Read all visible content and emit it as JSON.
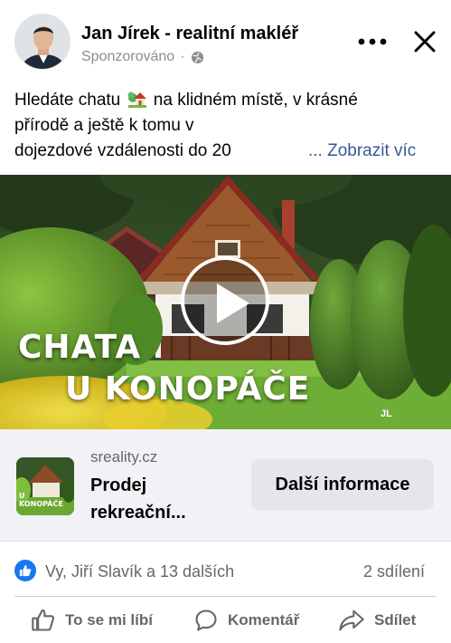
{
  "post": {
    "author": "Jan Jírek - realitní makléř",
    "sponsored": "Sponzorováno",
    "separator": "·",
    "icons": {
      "audience": "globe-icon",
      "more": "more-options-icon",
      "close": "close-icon"
    },
    "text_lines": [
      {
        "before": "Hledáte chatu",
        "emoji": "house-with-garden-emoji",
        "after": " na klidném místě, v krásné"
      },
      {
        "text": "přírodě a ještě k tomu v"
      },
      {
        "text": "dojezdové vzdálenosti do 20"
      }
    ],
    "see_more": "... Zobrazit víc"
  },
  "media": {
    "overlay_line1": "CHATA",
    "overlay_line2": "U KONOPÁČE",
    "watermark": "JL",
    "play_icon": "play-icon"
  },
  "link": {
    "domain": "sreality.cz",
    "title_line1": "Prodej",
    "title_line2": "rekreační...",
    "thumb_line1": "U",
    "thumb_line2": "KONOPÁČE",
    "cta": "Další informace"
  },
  "stats": {
    "reactors": "Vy, Jiří Slavík a 13 dalších",
    "shares": "2 sdílení",
    "reaction_icon": "like-reaction-icon"
  },
  "actions": [
    {
      "label": "To se mi líbí",
      "icon": "thumbs-up-icon"
    },
    {
      "label": "Komentář",
      "icon": "comment-icon"
    },
    {
      "label": "Sdílet",
      "icon": "share-icon"
    }
  ],
  "colors": {
    "link_blue": "#385898",
    "like_blue": "#1877f2",
    "muted_text": "#65676b",
    "cta_bg": "#e4e6eb",
    "link_box_bg": "#f0f2f5"
  }
}
